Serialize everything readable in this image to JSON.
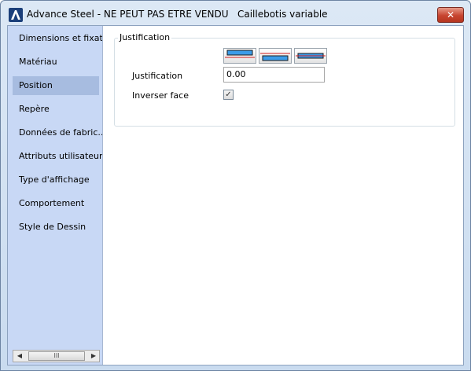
{
  "window": {
    "title": "Advance Steel - NE PEUT PAS ETRE VENDU   Caillebotis variable",
    "close_label": "✕"
  },
  "sidebar": {
    "items": [
      {
        "label": "Dimensions et fixat..."
      },
      {
        "label": "Matériau"
      },
      {
        "label": "Position"
      },
      {
        "label": "Repère"
      },
      {
        "label": "Données de fabric..."
      },
      {
        "label": "Attributs utilisateur"
      },
      {
        "label": "Type d'affichage"
      },
      {
        "label": "Comportement"
      },
      {
        "label": "Style de Dessin"
      }
    ],
    "selected_label": "Position",
    "scroll": {
      "left_arrow": "◀",
      "right_arrow": "▶",
      "thumb_grip": "III"
    }
  },
  "justification": {
    "group_label": "Justification",
    "field_label": "Justification",
    "value": "0.00",
    "buttons": [
      {
        "icon": "justify-top-icon"
      },
      {
        "icon": "justify-bottom-icon"
      },
      {
        "icon": "justify-center-icon"
      }
    ]
  },
  "inverse_face": {
    "label": "Inverser face",
    "checked": true,
    "check_glyph": "✓"
  },
  "colors": {
    "selected_item": "#a7bce0",
    "sidebar_background": "#c8d8f5",
    "blue_plate": "#3c9be8",
    "red_line": "#d11b1b"
  }
}
